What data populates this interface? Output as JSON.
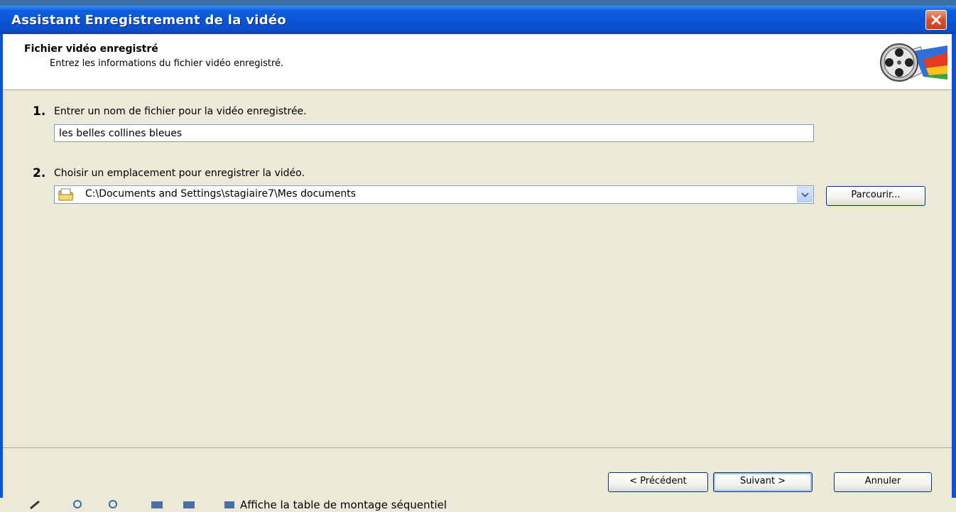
{
  "window": {
    "title": "Assistant Enregistrement de la vidéo"
  },
  "header": {
    "title": "Fichier vidéo enregistré",
    "subtitle": "Entrez les informations du fichier vidéo enregistré."
  },
  "step1": {
    "number": "1.",
    "label": "Entrer un nom de fichier pour la vidéo enregistrée.",
    "filename_value": "les belles collines bleues"
  },
  "step2": {
    "number": "2.",
    "label": "Choisir un emplacement pour enregistrer la vidéo.",
    "location_value": "C:\\Documents and Settings\\stagiaire7\\Mes documents",
    "browse_label": "Parcourir..."
  },
  "footer": {
    "prev_label": "< Précédent",
    "next_label": "Suivant >",
    "cancel_label": "Annuler"
  },
  "background": {
    "status_text": "Affiche la table de montage séquentiel"
  },
  "icons": {
    "close": "close-icon",
    "film": "film-reel-icon",
    "folder": "folder-icon",
    "dropdown": "chevron-down-icon"
  },
  "colors": {
    "titlebar": "#0a54d6",
    "dialog_face": "#ece9d8",
    "close_button": "#d6532f",
    "button_border": "#003c74"
  }
}
